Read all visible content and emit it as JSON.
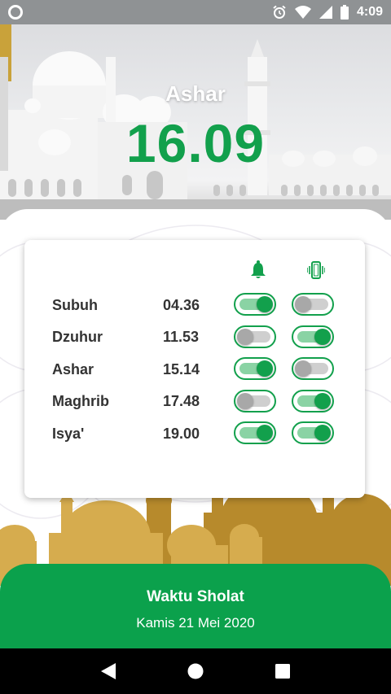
{
  "status_bar": {
    "time": "4:09",
    "icons": [
      "record-icon",
      "alarm-icon",
      "wifi-icon",
      "signal-icon",
      "battery-icon"
    ]
  },
  "current_prayer": {
    "name": "Ashar",
    "time": "16.09"
  },
  "schedule": {
    "header_icons": [
      "bell-icon",
      "vibrate-icon"
    ],
    "rows": [
      {
        "name": "Subuh",
        "time": "04.36",
        "alarm": true,
        "vibrate": false
      },
      {
        "name": "Dzuhur",
        "time": "11.53",
        "alarm": false,
        "vibrate": true
      },
      {
        "name": "Ashar",
        "time": "15.14",
        "alarm": true,
        "vibrate": false
      },
      {
        "name": "Maghrib",
        "time": "17.48",
        "alarm": false,
        "vibrate": true
      },
      {
        "name": "Isya'",
        "time": "19.00",
        "alarm": true,
        "vibrate": true
      }
    ]
  },
  "footer": {
    "title": "Waktu Sholat",
    "date": "Kamis 21 Mei 2020"
  },
  "nav_bar": {
    "buttons": [
      "back-icon",
      "home-icon",
      "recents-icon"
    ]
  },
  "colors": {
    "accent": "#12a04c",
    "footer_bg": "#0ba14c",
    "toggle_off": "#a8a8a8",
    "status_bar": "#8f9294"
  }
}
